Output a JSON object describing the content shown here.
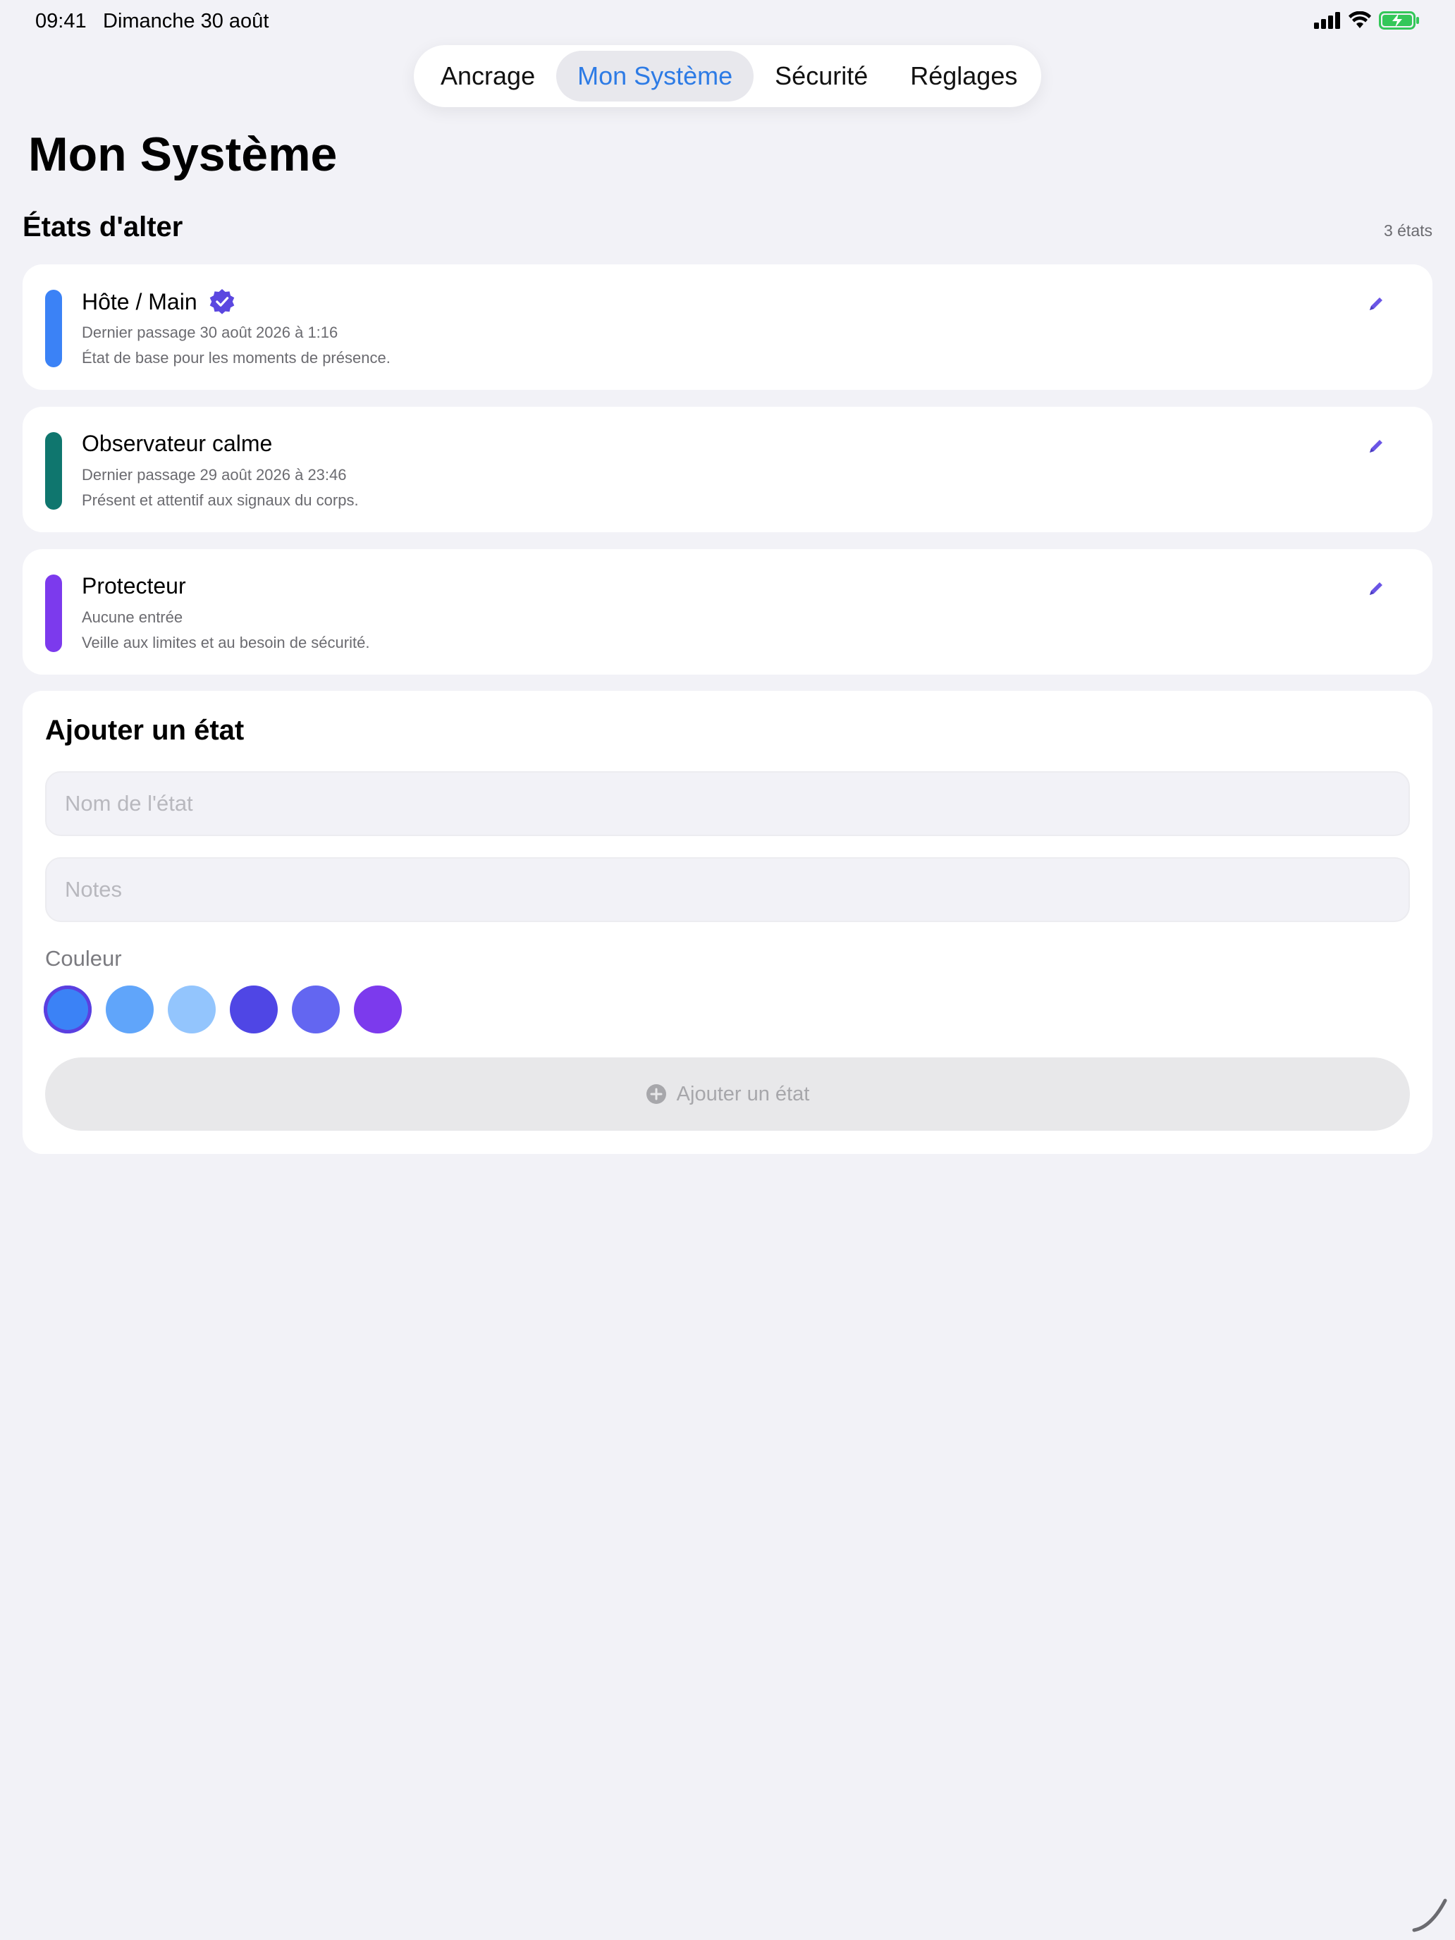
{
  "status_bar": {
    "time": "09:41",
    "date": "Dimanche 30 août"
  },
  "tabs": [
    {
      "label": "Ancrage",
      "active": false
    },
    {
      "label": "Mon Système",
      "active": true
    },
    {
      "label": "Sécurité",
      "active": false
    },
    {
      "label": "Réglages",
      "active": false
    }
  ],
  "page_title": "Mon Système",
  "section": {
    "title": "États d'alter",
    "count": "3 états"
  },
  "alters": [
    {
      "name": "Hôte / Main",
      "last": "Dernier passage 30 août 2026 à 1:16",
      "notes": "État de base pour les moments de présence.",
      "color": "#3b82f6",
      "verified": true
    },
    {
      "name": "Observateur calme",
      "last": "Dernier passage 29 août 2026 à 23:46",
      "notes": "Présent et attentif aux signaux du corps.",
      "color": "#0f766e",
      "verified": false
    },
    {
      "name": "Protecteur",
      "last": "Aucune entrée",
      "notes": "Veille aux limites et au besoin de sécurité.",
      "color": "#7c3aed",
      "verified": false
    }
  ],
  "add_form": {
    "title": "Ajouter un état",
    "name_placeholder": "Nom de l'état",
    "notes_placeholder": "Notes",
    "color_label": "Couleur",
    "colors": [
      "#3b82f6",
      "#60a5fa",
      "#93c5fd",
      "#4f46e5",
      "#6366f1",
      "#7c3aed"
    ],
    "selected_color_index": 0,
    "submit_label": "Ajouter un état"
  },
  "accent_color": "#2d7be5",
  "icons": {
    "verified": "verified-badge-icon",
    "edit": "pencil-icon",
    "add": "plus-circle-icon"
  }
}
